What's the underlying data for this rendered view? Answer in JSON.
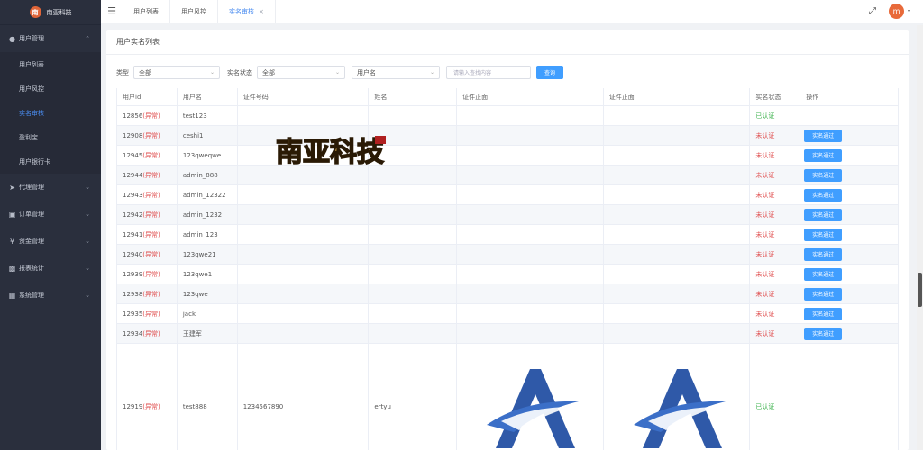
{
  "brand": {
    "name": "南亚科技",
    "logo_text": "南"
  },
  "sidebar": {
    "groups": [
      {
        "label": "用户管理",
        "icon": "user-icon",
        "expanded": true,
        "items": [
          "用户列表",
          "用户风控",
          "实名审核",
          "盈利宝",
          "用户银行卡"
        ]
      },
      {
        "label": "代理管理",
        "icon": "send-icon"
      },
      {
        "label": "订单管理",
        "icon": "order-icon"
      },
      {
        "label": "资金管理",
        "icon": "yen-icon"
      },
      {
        "label": "报表统计",
        "icon": "chart-icon"
      },
      {
        "label": "系统管理",
        "icon": "grid-icon"
      }
    ],
    "active_item": "实名审核"
  },
  "header": {
    "tabs": [
      {
        "label": "用户列表"
      },
      {
        "label": "用户风控"
      },
      {
        "label": "实名审核",
        "active": true,
        "close": "×"
      }
    ],
    "avatar_text": "m"
  },
  "card": {
    "title": "用户实名列表"
  },
  "filters": {
    "type_label": "类型",
    "type_value": "全部",
    "status_label": "实名状态",
    "status_value": "全部",
    "field_value": "用户名",
    "search_placeholder": "请输入查找内容",
    "query_label": "查询"
  },
  "table": {
    "headers": [
      "用户id",
      "用户名",
      "证件号码",
      "姓名",
      "证件正面",
      "证件正面",
      "实名状态",
      "操作"
    ],
    "abnormal_tag": "(异常)",
    "action_label": "实名通过",
    "rows": [
      {
        "id": "12856",
        "abnormal": true,
        "username": "test123",
        "idno": "",
        "name": "",
        "status": "已认证",
        "verified": true
      },
      {
        "id": "12908",
        "abnormal": true,
        "username": "ceshi1",
        "idno": "",
        "name": "",
        "status": "未认证",
        "verified": false
      },
      {
        "id": "12945",
        "abnormal": true,
        "username": "123qweqwe",
        "idno": "",
        "name": "",
        "status": "未认证",
        "verified": false
      },
      {
        "id": "12944",
        "abnormal": true,
        "username": "admin_888",
        "idno": "",
        "name": "",
        "status": "未认证",
        "verified": false
      },
      {
        "id": "12943",
        "abnormal": true,
        "username": "admin_12322",
        "idno": "",
        "name": "",
        "status": "未认证",
        "verified": false
      },
      {
        "id": "12942",
        "abnormal": true,
        "username": "admin_1232",
        "idno": "",
        "name": "",
        "status": "未认证",
        "verified": false
      },
      {
        "id": "12941",
        "abnormal": true,
        "username": "admin_123",
        "idno": "",
        "name": "",
        "status": "未认证",
        "verified": false
      },
      {
        "id": "12940",
        "abnormal": true,
        "username": "123qwe21",
        "idno": "",
        "name": "",
        "status": "未认证",
        "verified": false
      },
      {
        "id": "12939",
        "abnormal": true,
        "username": "123qwe1",
        "idno": "",
        "name": "",
        "status": "未认证",
        "verified": false
      },
      {
        "id": "12938",
        "abnormal": true,
        "username": "123qwe",
        "idno": "",
        "name": "",
        "status": "未认证",
        "verified": false
      },
      {
        "id": "12935",
        "abnormal": true,
        "username": "jack",
        "idno": "",
        "name": "",
        "status": "未认证",
        "verified": false
      },
      {
        "id": "12934",
        "abnormal": true,
        "username": "王建军",
        "idno": "",
        "name": "",
        "status": "未认证",
        "verified": false
      },
      {
        "id": "12919",
        "abnormal": true,
        "username": "test888",
        "idno": "1234567890",
        "name": "ertyu",
        "status": "已认证",
        "verified": true,
        "has_images": true
      }
    ]
  },
  "watermark_text": "南亚科技",
  "colors": {
    "sidebar_bg": "#2a2f3d",
    "accent": "#409eff",
    "ok": "#3fb34f",
    "danger": "#e05050"
  }
}
